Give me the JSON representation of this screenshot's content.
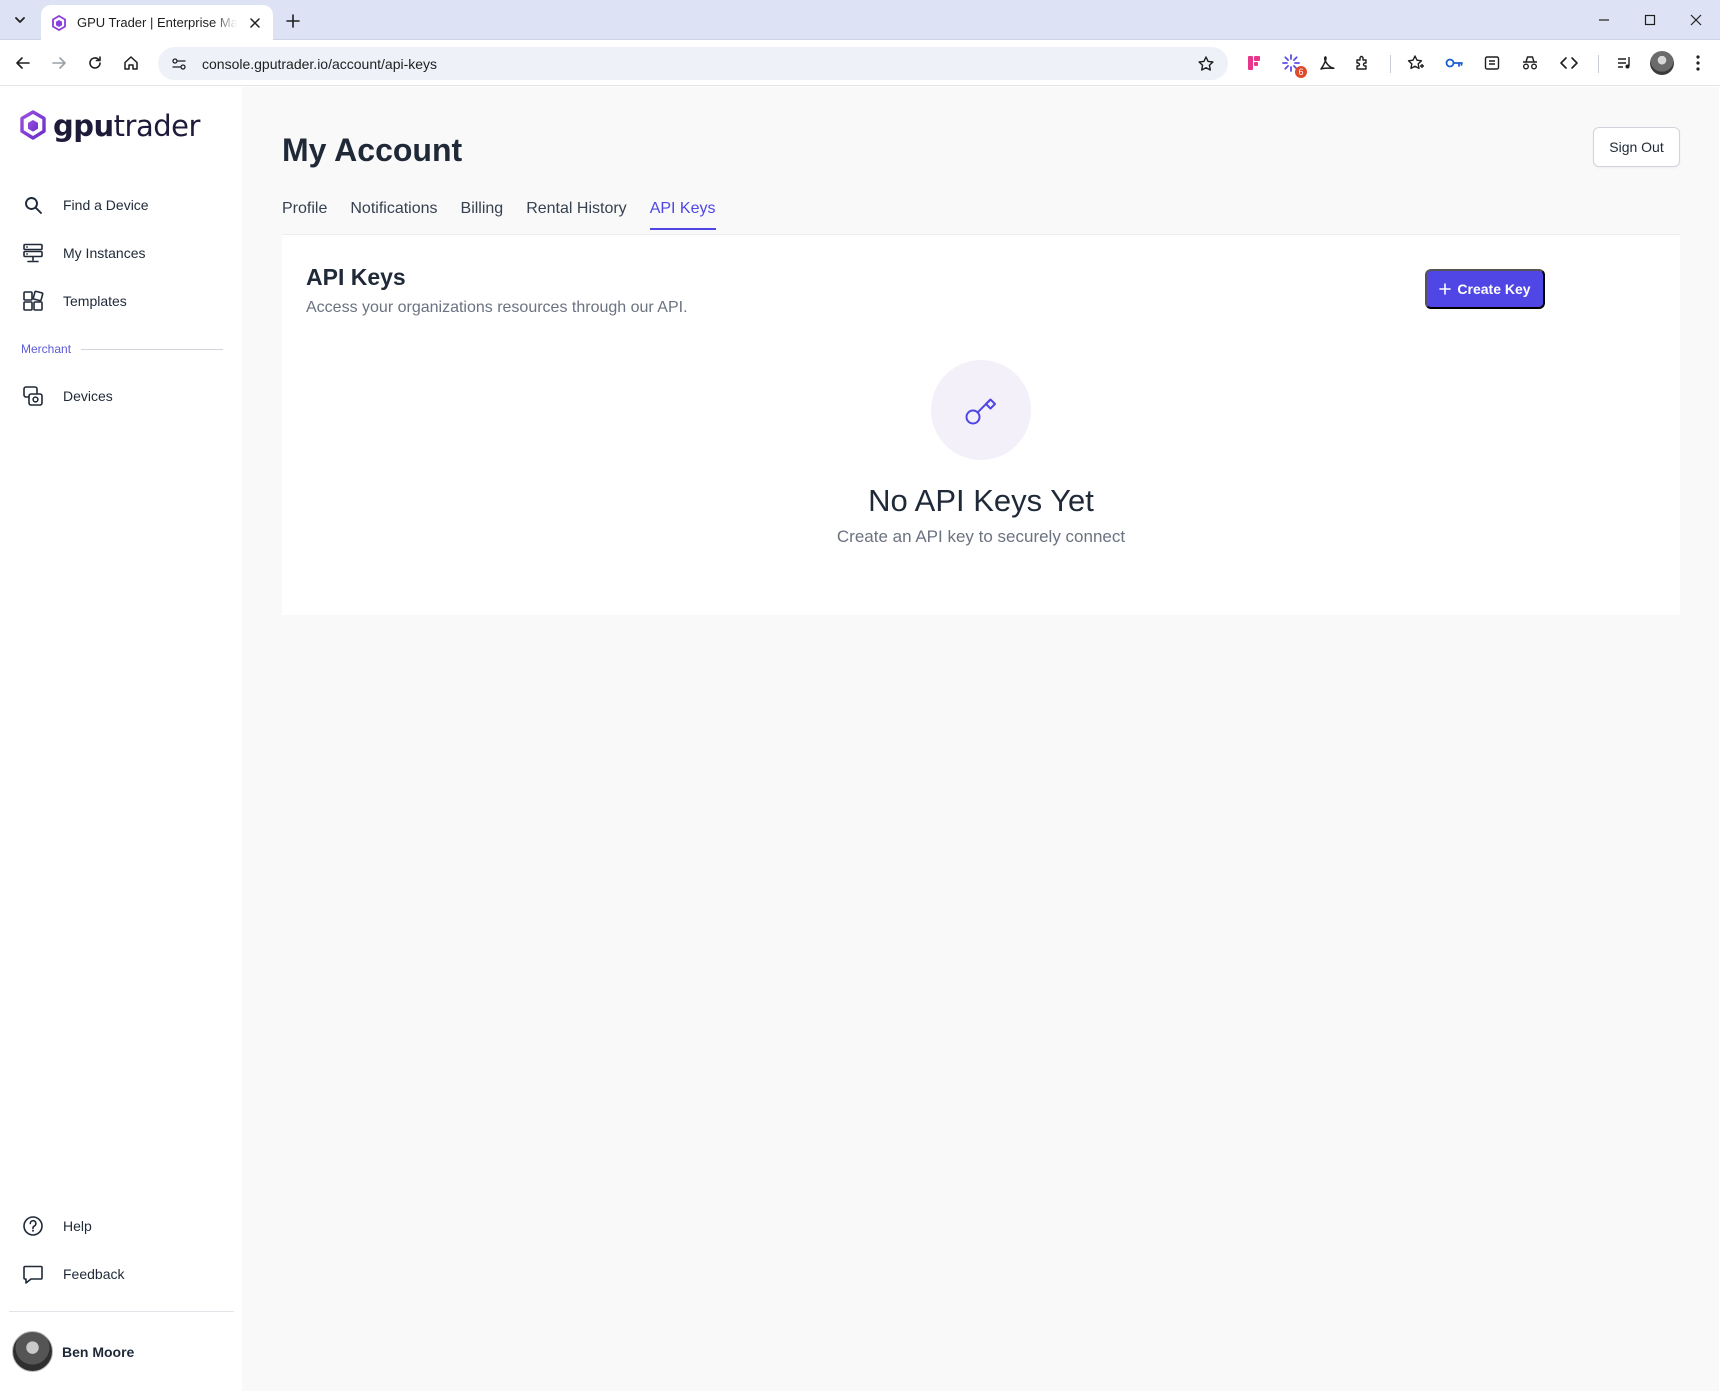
{
  "browser": {
    "tab_title": "GPU Trader | Enterprise Marketplace",
    "url": "console.gputrader.io/account/api-keys",
    "extension_badge": "6"
  },
  "sidebar": {
    "logo_prefix": "gpu",
    "logo_suffix": "trader",
    "items": [
      {
        "label": "Find a Device",
        "icon": "search-icon"
      },
      {
        "label": "My Instances",
        "icon": "instances-icon"
      },
      {
        "label": "Templates",
        "icon": "templates-icon"
      }
    ],
    "section_label": "Merchant",
    "merchant_items": [
      {
        "label": "Devices",
        "icon": "devices-icon"
      }
    ],
    "bottom_items": [
      {
        "label": "Help",
        "icon": "help-icon"
      },
      {
        "label": "Feedback",
        "icon": "feedback-icon"
      }
    ],
    "user_name": "Ben Moore"
  },
  "main": {
    "page_title": "My Account",
    "sign_out_label": "Sign Out",
    "tabs": [
      "Profile",
      "Notifications",
      "Billing",
      "Rental History",
      "API Keys"
    ],
    "active_tab": "API Keys",
    "panel": {
      "title": "API Keys",
      "subtitle": "Access your organizations resources through our API.",
      "create_label": "Create Key",
      "empty_title": "No API Keys Yet",
      "empty_subtitle": "Create an API key to securely connect"
    }
  },
  "colors": {
    "accent": "#4f46e5",
    "section_label": "#5b5bd6",
    "empty_icon_bg": "#f3f0fa"
  }
}
